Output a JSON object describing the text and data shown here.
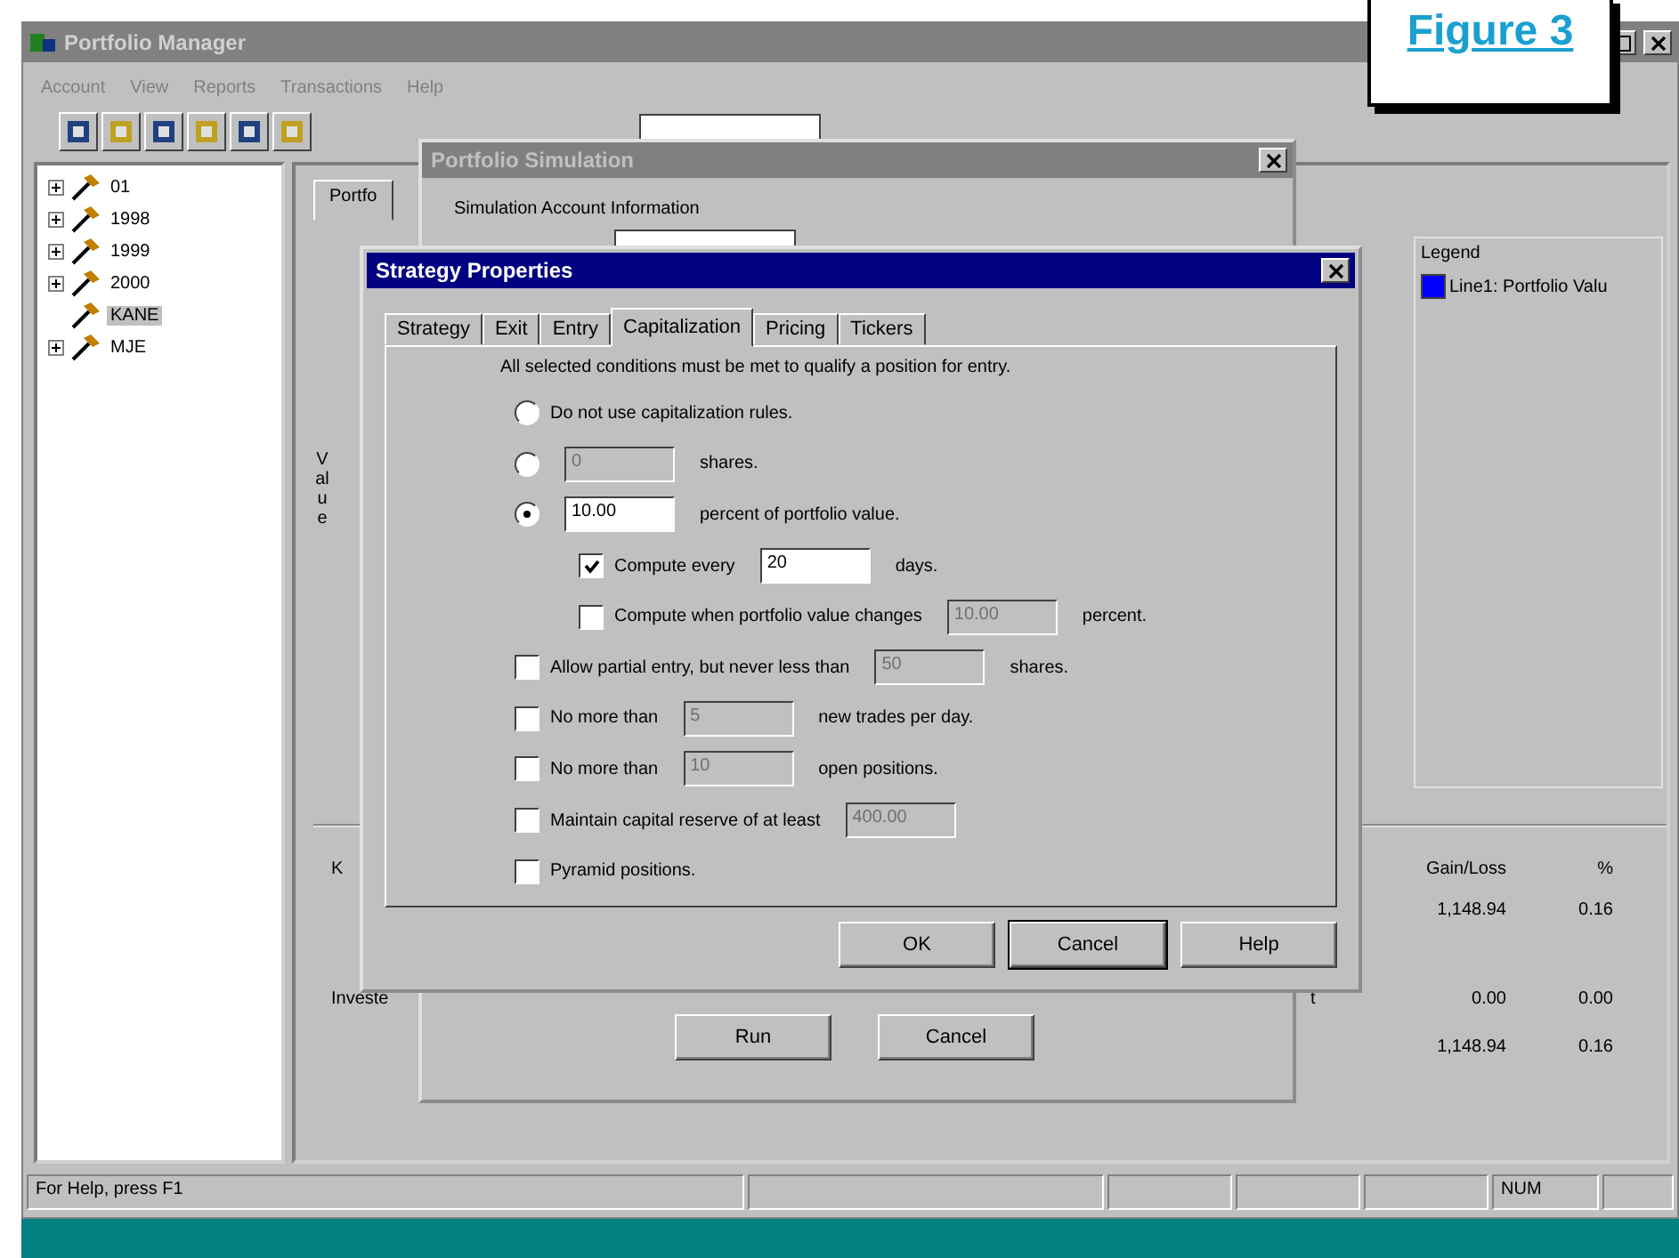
{
  "figure_label": "Figure 3",
  "window": {
    "title": "Portfolio Manager"
  },
  "menu": [
    "Account",
    "View",
    "Reports",
    "Transactions",
    "Help"
  ],
  "tree": [
    {
      "label": "01",
      "kind": "collapsed",
      "selected": false
    },
    {
      "label": "1998",
      "kind": "collapsed",
      "selected": false
    },
    {
      "label": "1999",
      "kind": "collapsed",
      "selected": false
    },
    {
      "label": "2000",
      "kind": "collapsed",
      "selected": false
    },
    {
      "label": "KANE",
      "kind": "leaf",
      "selected": true
    },
    {
      "label": "MJE",
      "kind": "collapsed",
      "selected": false
    }
  ],
  "panel_tab": "Portfo",
  "chart_axis_label": "Value",
  "legend": {
    "title": "Legend",
    "items": [
      {
        "label": "Line1: Portfolio Valu",
        "color": "#0000ff"
      }
    ]
  },
  "summary": {
    "rows": [
      {
        "column_1": "K",
        "column_2": "",
        "gain_loss": "Gain/Loss",
        "percent": "%"
      },
      {
        "column_1": "",
        "column_2": "",
        "gain_loss": "1,148.94",
        "percent": "0.16"
      },
      {
        "column_1": "Investe",
        "column_2": "t",
        "gain_loss": "0.00",
        "percent": "0.00"
      },
      {
        "column_1": "",
        "column_2": "",
        "gain_loss": "1,148.94",
        "percent": "0.16"
      }
    ]
  },
  "status_bar": {
    "text": "For Help, press F1",
    "indicator": "NUM"
  },
  "simulation_dialog": {
    "title": "Portfolio Simulation",
    "group_label": "Simulation Account Information",
    "buttons": [
      "Run",
      "Cancel"
    ]
  },
  "strategy_dialog": {
    "title": "Strategy Properties",
    "tabs": [
      {
        "label": "Strategy",
        "selected": false
      },
      {
        "label": "Exit",
        "selected": false
      },
      {
        "label": "Entry",
        "selected": false
      },
      {
        "label": "Capitalization",
        "selected": true
      },
      {
        "label": "Pricing",
        "selected": false
      },
      {
        "label": "Tickers",
        "selected": false
      }
    ],
    "intro": "All selected conditions must be met to qualify a position for entry.",
    "options": [
      {
        "kind": "radio",
        "checked": false,
        "label": "Do not use capitalization rules."
      },
      {
        "kind": "radio",
        "checked": false,
        "field": {
          "value": "0",
          "disabled": true
        },
        "suffix": "shares."
      },
      {
        "kind": "radio",
        "checked": true,
        "field": {
          "value": "10.00",
          "disabled": false
        },
        "suffix": "percent of portfolio value.",
        "children": [
          {
            "kind": "checkbox",
            "checked": true,
            "label": "Compute every",
            "field": {
              "value": "20",
              "disabled": false
            },
            "suffix": "days."
          },
          {
            "kind": "checkbox",
            "checked": false,
            "label": "Compute when portfolio value changes",
            "field": {
              "value": "10.00",
              "disabled": true
            },
            "suffix": "percent."
          }
        ]
      },
      {
        "kind": "checkbox",
        "checked": false,
        "label": "Allow partial entry, but never less than",
        "field": {
          "value": "50",
          "disabled": true
        },
        "suffix": "shares."
      },
      {
        "kind": "checkbox",
        "checked": false,
        "label": "No more than",
        "field": {
          "value": "5",
          "disabled": true
        },
        "suffix": "new trades per day."
      },
      {
        "kind": "checkbox",
        "checked": false,
        "label": "No more than",
        "field": {
          "value": "10",
          "disabled": true
        },
        "suffix": "open positions."
      },
      {
        "kind": "checkbox",
        "checked": false,
        "label": "Maintain capital reserve of at least",
        "field": {
          "value": "400.00",
          "disabled": true
        }
      },
      {
        "kind": "checkbox",
        "checked": false,
        "label": "Pyramid positions."
      }
    ],
    "buttons": [
      {
        "label": "OK",
        "default": false
      },
      {
        "label": "Cancel",
        "default": true
      },
      {
        "label": "Help",
        "default": false
      }
    ]
  }
}
